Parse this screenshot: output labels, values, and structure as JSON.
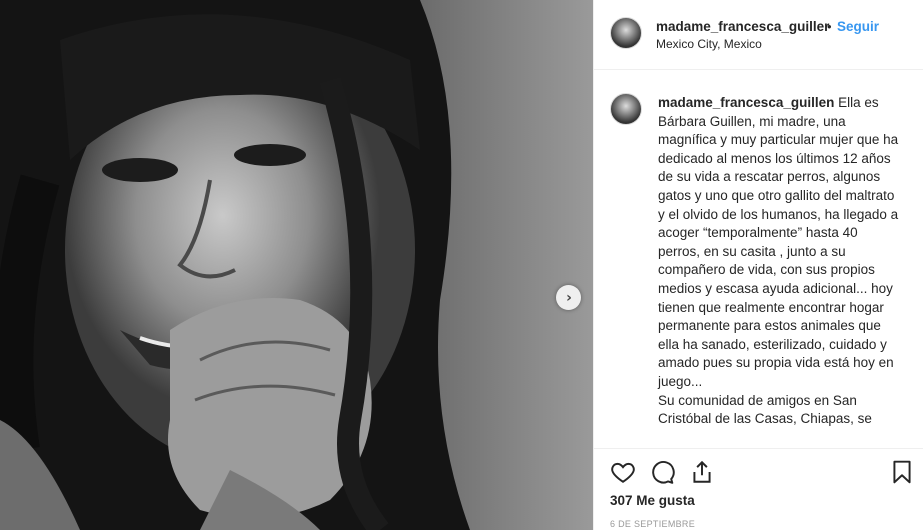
{
  "post": {
    "author": "madame_francesca_guiller",
    "follow_label": "Seguir",
    "separator": "•",
    "location": "Mexico City, Mexico",
    "caption_author": "madame_francesca_guillen",
    "caption_text": "Ella es Bárbara Guillen, mi madre, una magnífica y muy particular mujer que ha dedicado al menos los últimos 12 años de su vida a rescatar perros, algunos gatos y uno que otro gallito del maltrato y el olvido de los humanos, ha llegado a acoger “temporalmente” hasta 40 perros, en su casita , junto a su compañero de vida, con sus propios medios y escasa ayuda adicional... hoy tienen que realmente encontrar hogar permanente para estos animales que ella ha sanado, esterilizado, cuidado y amado pues su propia vida está hoy en juego...",
    "caption_text_2": "Su comunidad de amigos en San Cristóbal de las Casas, Chiapas, se",
    "likes": "307 Me gusta",
    "date": "6 DE SEPTIEMBRE"
  },
  "icons": {
    "like": "heart-icon",
    "comment": "comment-icon",
    "share": "share-icon",
    "save": "bookmark-icon",
    "next": "chevron-right-icon"
  },
  "colors": {
    "follow": "#3897f0",
    "text": "#262626",
    "muted": "#999999",
    "divider": "#efefef"
  }
}
